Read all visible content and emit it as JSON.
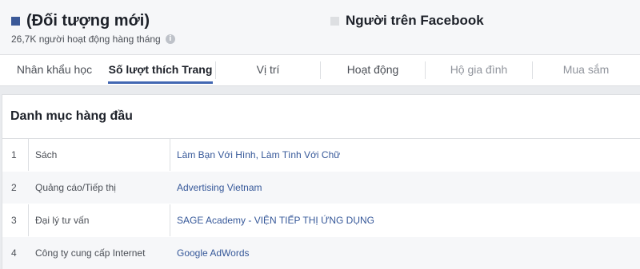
{
  "audiences": {
    "left": {
      "title": "(Đối tượng mới)",
      "subtitle": "26,7K người hoạt động hàng tháng",
      "color": "#3b5998",
      "info_icon": "info-icon"
    },
    "right": {
      "title": "Người trên Facebook",
      "color": "#dddfe2"
    }
  },
  "tabs": [
    {
      "label": "Nhân khẩu học",
      "state": "normal"
    },
    {
      "label": "Số lượt thích Trang",
      "state": "active"
    },
    {
      "label": "Vị trí",
      "state": "normal"
    },
    {
      "label": "Hoạt động",
      "state": "normal"
    },
    {
      "label": "Hộ gia đình",
      "state": "disabled"
    },
    {
      "label": "Mua sắm",
      "state": "disabled"
    }
  ],
  "top_categories": {
    "title": "Danh mục hàng đầu",
    "rows": [
      {
        "rank": "1",
        "category": "Sách",
        "pages": "Làm Bạn Với Hình, Làm Tình Với Chữ"
      },
      {
        "rank": "2",
        "category": "Quảng cáo/Tiếp thị",
        "pages": "Advertising Vietnam"
      },
      {
        "rank": "3",
        "category": "Đại lý tư vấn",
        "pages": "SAGE Academy - VIỆN TIẾP THỊ ỨNG DỤNG"
      },
      {
        "rank": "4",
        "category": "Công ty cung cấp Internet",
        "pages": "Google AdWords"
      }
    ]
  },
  "colors": {
    "accent": "#4267b2",
    "link": "#365899"
  }
}
